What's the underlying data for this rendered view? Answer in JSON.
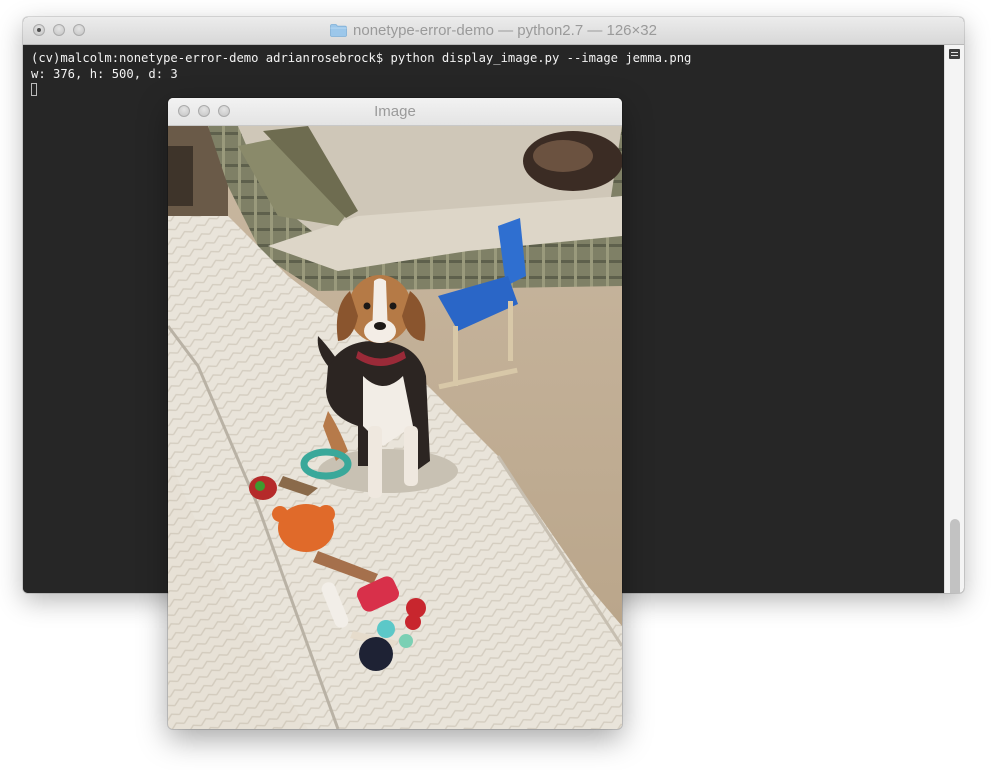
{
  "terminal": {
    "title": "nonetype-error-demo — python2.7 — 126×32",
    "lines": [
      "(cv)malcolm:nonetype-error-demo adrianrosebrock$ python display_image.py --image jemma.png",
      "w: 376, h: 500, d: 3"
    ],
    "icons": {
      "folder": "folder-icon",
      "close": "close-icon",
      "minimize": "minimize-icon",
      "zoom": "zoom-icon",
      "menu": "menu-icon"
    }
  },
  "image_window": {
    "title": "Image",
    "photo_subject": "beagle-photo"
  },
  "colors": {
    "terminal_bg": "#262626",
    "terminal_text": "#f2f2f2",
    "titlebar": "#e4e4e4",
    "title_text": "#9a9a9a"
  }
}
